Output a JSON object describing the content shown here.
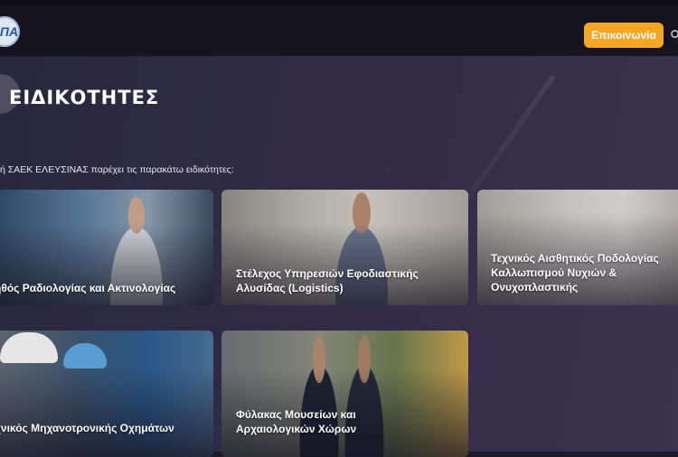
{
  "header": {
    "logo_text": "ΠΑ",
    "contact_button": "Επικοινωνία",
    "accent_color": "#f5a623"
  },
  "hero": {
    "title": "ΕΙΔΙΚΟΤΗΤΕΣ",
    "intro": "ή ΣΑΕΚ ΕΛΕΥΣΙΝΑΣ παρέχει τις παρακάτω ειδικότητες:"
  },
  "specialties": [
    {
      "label": "ηθός Ραδιολογίας και Ακτινολογίας"
    },
    {
      "label": "Στέλεχος Υπηρεσιών Εφοδιαστικής Αλυσίδας (Logistics)"
    },
    {
      "label": "Τεχνικός Αισθητικός Ποδολογίας Καλλωπισμού Νυχιών & Ονυχοπλαστικής"
    },
    {
      "label": "χνικός Μηχανοτρονικής Οχημάτων"
    },
    {
      "label": "Φύλακας Μουσείων και Αρχαιολογικών Χώρων"
    }
  ]
}
